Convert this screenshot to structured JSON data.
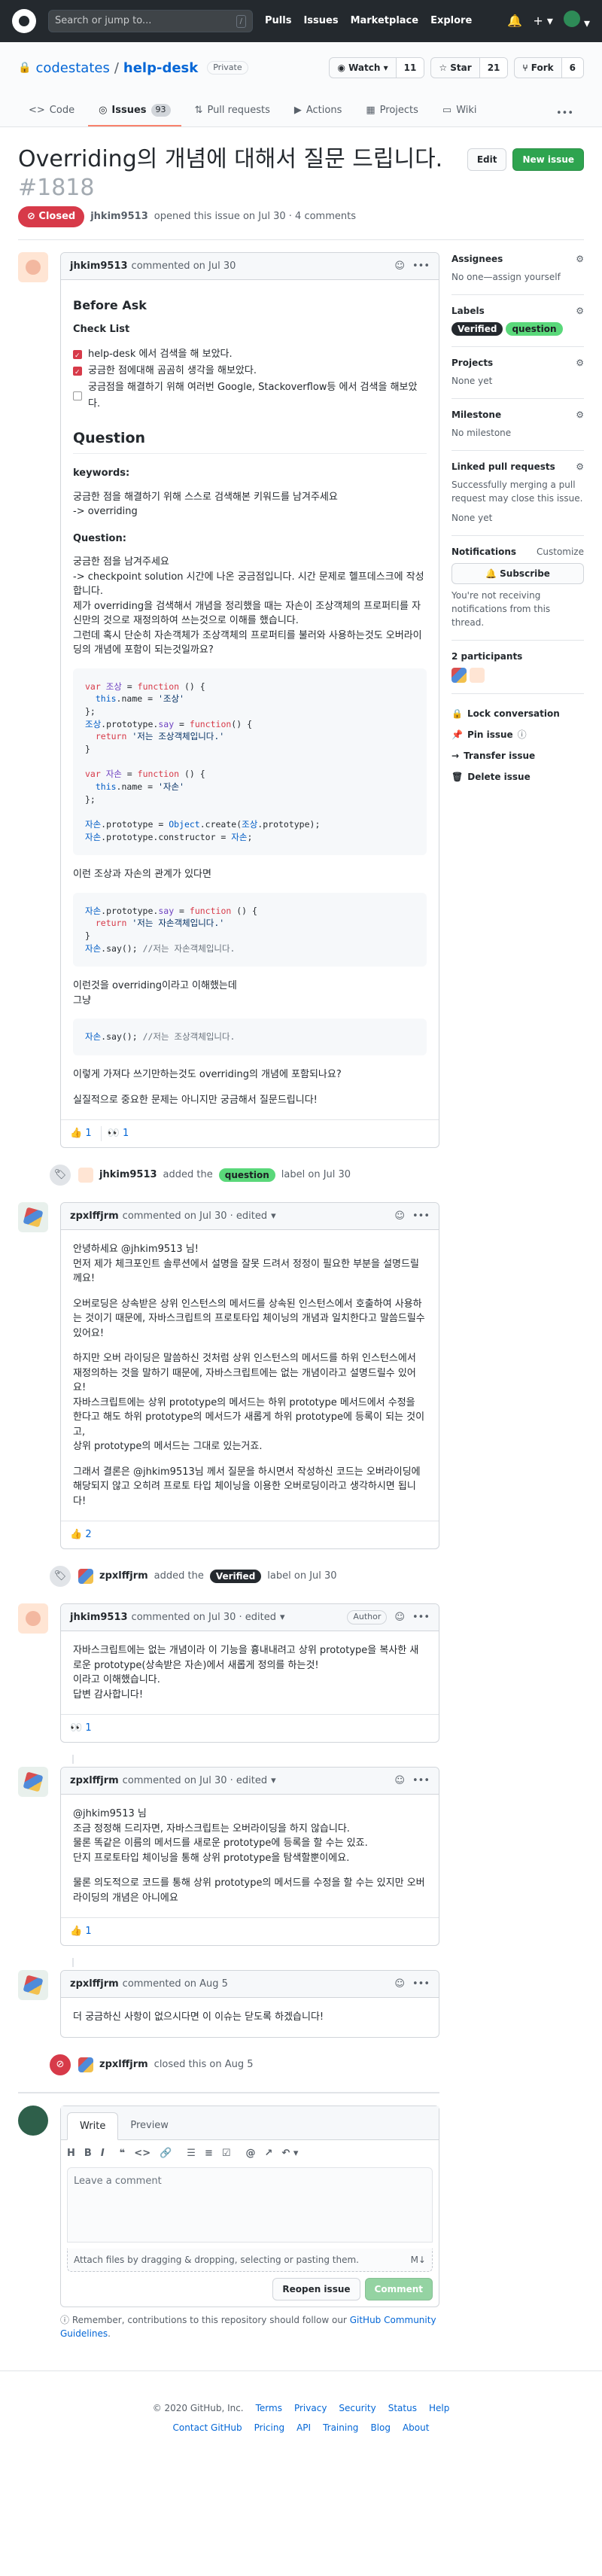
{
  "header": {
    "search_placeholder": "Search or jump to...",
    "search_shortcut": "/",
    "nav": [
      "Pulls",
      "Issues",
      "Marketplace",
      "Explore"
    ]
  },
  "repo": {
    "owner": "codestates",
    "name": "help-desk",
    "visibility": "Private",
    "watch_label": "Watch",
    "watch_count": "11",
    "star_label": "Star",
    "star_count": "21",
    "fork_label": "Fork",
    "fork_count": "6",
    "tabs": [
      {
        "label": "Code",
        "icon": "<>"
      },
      {
        "label": "Issues",
        "count": "93",
        "icon": "◎"
      },
      {
        "label": "Pull requests",
        "icon": "⇅"
      },
      {
        "label": "Actions",
        "icon": "▶"
      },
      {
        "label": "Projects",
        "icon": "▦"
      },
      {
        "label": "Wiki",
        "icon": "▭"
      }
    ]
  },
  "issue": {
    "title": "Overriding의 개념에 대해서 질문 드립니다.",
    "number": "#1818",
    "state": "Closed",
    "author": "jhkim9513",
    "meta": "opened this issue on Jul 30 · 4 comments",
    "edit_label": "Edit",
    "new_issue_label": "New issue"
  },
  "first_comment": {
    "author": "jhkim9513",
    "meta": "commented on Jul 30",
    "before_ask": "Before Ask",
    "checklist_title": "Check List",
    "checklist": [
      {
        "text": "help-desk 에서 검색을 해 보았다.",
        "checked": true
      },
      {
        "text": "궁금한 점에대해 곰곰히 생각을 해보았다.",
        "checked": true
      },
      {
        "text": "궁금점을 해결하기 위해 여러번 Google, Stackoverflow등 에서 검색을 해보았다.",
        "checked": false
      }
    ],
    "question_heading": "Question",
    "keywords_label": "keywords:",
    "keywords_p1": "궁금한 점을 해결하기 위해 스스로 검색해본 키워드를 남겨주세요",
    "keywords_p2": "-> overriding",
    "question_label": "Question:",
    "q_lines": [
      "궁금한 점을 남겨주세요",
      "-> checkpoint solution 시간에 나온 궁금점입니다. 시간 문제로 헬프데스크에 작성합니다.",
      "제가 overriding을 검색해서 개념을 정리했을 때는 자손이 조상객체의 프로퍼티를 자신만의 것으로 재정의하여 쓰는것으로 이해를 했습니다.",
      "그런데 혹시 단순히 자손객체가 조상객체의 프로퍼티를 불러와 사용하는것도 오버라이딩의 개념에 포함이 되는것일까요?"
    ],
    "relation_text": "이런 조상과 자손의 관계가 있다면",
    "override_text_1": "이런것을 overriding이라고 이해했는데",
    "override_text_2": "그냥",
    "final_q": "이렇게 가져다 쓰기만하는것도 overriding의 개념에 포함되나요?",
    "final_thanks": "실질적으로 중요한 문제는 아니지만 궁금해서 질문드립니다!",
    "reactions": [
      {
        "emoji": "👍",
        "count": "1"
      },
      {
        "emoji": "👀",
        "count": "1"
      }
    ]
  },
  "code1": {
    "l1a": "var ",
    "l1b": "조상",
    "l1c": " = ",
    "l1d": "function",
    "l1e": " () {",
    "l2a": "  this",
    "l2b": ".name = ",
    "l2c": "'조상'",
    "l3": "};",
    "l4a": "조상",
    "l4b": ".prototype.",
    "l4c": "say",
    "l4d": " = ",
    "l4e": "function",
    "l4f": "() {",
    "l5a": "  return ",
    "l5b": "'저는 조상객체입니다.'",
    "l6": "}",
    "l7a": "var ",
    "l7b": "자손",
    "l7c": " = ",
    "l7d": "function",
    "l7e": " () {",
    "l8a": "  this",
    "l8b": ".name = ",
    "l8c": "'자손'",
    "l9": "};",
    "l10a": "자손",
    "l10b": ".prototype = ",
    "l10c": "Object",
    "l10d": ".create(",
    "l10e": "조상",
    "l10f": ".prototype);",
    "l11a": "자손",
    "l11b": ".prototype.constructor = ",
    "l11c": "자손",
    "l11d": ";"
  },
  "code2": {
    "l1a": "자손",
    "l1b": ".prototype.",
    "l1c": "say",
    "l1d": " = ",
    "l1e": "function",
    "l1f": " () {",
    "l2a": "  return ",
    "l2b": "'저는 자손객체입니다.'",
    "l3": "}",
    "l4a": "자손",
    "l4b": ".say(); ",
    "l4c": "//저는 자손객체입니다."
  },
  "code3": {
    "l1a": "자손",
    "l1b": ".say(); ",
    "l1c": "//저는 조상객체입니다."
  },
  "event_label_added": {
    "actor": "jhkim9513",
    "pre": "added the",
    "label": "question",
    "post": "label on Jul 30"
  },
  "comment2": {
    "author": "zpxlffjrm",
    "meta": "commented on Jul 30 · edited",
    "paragraphs": [
      "안녕하세요 @jhkim9513 님!",
      "먼저 제가 체크포인트 솔루션에서 설명을 잘못 드려서 정정이 필요한 부분을 설명드릴께요!",
      "오버로딩은 상속받은 상위 인스턴스의 메서드를 상속된 인스턴스에서 호출하여 사용하는 것이기 때문에, 자바스크립트의 프로토타입 체이닝의 개념과 일치한다고 말씀드릴수 있어요!",
      "하지만 오버 라이딩은 말씀하신 것처럼 상위 인스턴스의 메서드를 하위 인스턴스에서 재정의하는 것을 말하기 때문에, 자바스크립트에는 없는 개념이라고 설명드릴수 있어요!",
      "자바스크립트에는 상위 prototype의 메서드는 하위 prototype 메서드에서 수정을 한다고 해도 하위 prototype의 메서드가 새롭게 하위 prototype에 등록이 되는 것이고,",
      "상위 prototype의 메서드는 그대로 있는거죠.",
      "그래서 결론은 @jhkim9513님 께서 질문을 하시면서 작성하신 코드는 오버라이딩에 해당되지 않고 오히려 프로토 타입 체이닝을 이용한 오버로딩이라고 생각하시면 됩니다!"
    ],
    "reactions": [
      {
        "emoji": "👍",
        "count": "2"
      }
    ]
  },
  "event_verified": {
    "actor": "zpxlffjrm",
    "pre": "added the",
    "label": "Verified",
    "post": "label on Jul 30"
  },
  "comment3": {
    "author": "jhkim9513",
    "meta": "commented on Jul 30 · edited",
    "role": "Author",
    "lines": [
      "자바스크립트에는 없는 개념이라 이 기능을 흉내내려고 상위 prototype을 복사한 새로운 prototype(상속받은 자손)에서 새롭게 정의를 하는것!",
      "이라고 이해했습니다.",
      "답변 감사합니다!"
    ],
    "reactions": [
      {
        "emoji": "👀",
        "count": "1"
      }
    ]
  },
  "comment4": {
    "author": "zpxlffjrm",
    "meta": "commented on Jul 30 · edited",
    "lines": [
      "@jhkim9513 님",
      "조금 정정해 드리자면, 자바스크립트는 오버라이딩을 하지 않습니다.",
      "물론 똑같은 이름의 메서드를 새로운 prototype에 등록을 할 수는 있죠.",
      "단지 프로토타입 체이닝을 통해 상위 prototype을 탐색할뿐이에요."
    ],
    "last": "물론 의도적으로 코드를 통해 상위 prototype의 메서드를 수정을 할 수는 있지만 오버라이딩의 개념은 아니에요",
    "reactions": [
      {
        "emoji": "👍",
        "count": "1"
      }
    ]
  },
  "comment5": {
    "author": "zpxlffjrm",
    "meta": "commented on Aug 5",
    "text": "더 궁금하신 사항이 없으시다면 이 이슈는 닫도록 하겠습니다!"
  },
  "event_closed": {
    "actor": "zpxlffjrm",
    "text": "closed this on Aug 5"
  },
  "sidebar": {
    "assignees_h": "Assignees",
    "assignees_v": "No one—assign yourself",
    "labels_h": "Labels",
    "labels": [
      "Verified",
      "question"
    ],
    "projects_h": "Projects",
    "projects_v": "None yet",
    "milestone_h": "Milestone",
    "milestone_v": "No milestone",
    "linked_h": "Linked pull requests",
    "linked_desc": "Successfully merging a pull request may close this issue.",
    "linked_v": "None yet",
    "notif_h": "Notifications",
    "notif_customize": "Customize",
    "subscribe": "Subscribe",
    "notif_desc": "You're not receiving notifications from this thread.",
    "participants_h": "2 participants",
    "actions": [
      {
        "icon": "lock-icon",
        "label": "Lock conversation"
      },
      {
        "icon": "pin-icon",
        "label": "Pin issue"
      },
      {
        "icon": "transfer-icon",
        "label": "Transfer issue"
      },
      {
        "icon": "trash-icon",
        "label": "Delete issue"
      }
    ]
  },
  "composer": {
    "write_tab": "Write",
    "preview_tab": "Preview",
    "placeholder": "Leave a comment",
    "attach": "Attach files by dragging & dropping, selecting or pasting them.",
    "markdown": "M↓",
    "reopen": "Reopen issue",
    "comment": "Comment",
    "contrib_pre": "Remember, contributions to this repository should follow our",
    "contrib_link": "GitHub Community Guidelines",
    "contrib_post": "."
  },
  "footer": {
    "copyright": "© 2020 GitHub, Inc.",
    "row1": [
      "Terms",
      "Privacy",
      "Security",
      "Status",
      "Help"
    ],
    "row2": [
      "Contact GitHub",
      "Pricing",
      "API",
      "Training",
      "Blog",
      "About"
    ]
  },
  "colors": {
    "closed": "#d73a49",
    "green": "#2ea44f",
    "link": "#0366d6",
    "header_bg": "#24292e",
    "question_label": "#5ad87a"
  }
}
